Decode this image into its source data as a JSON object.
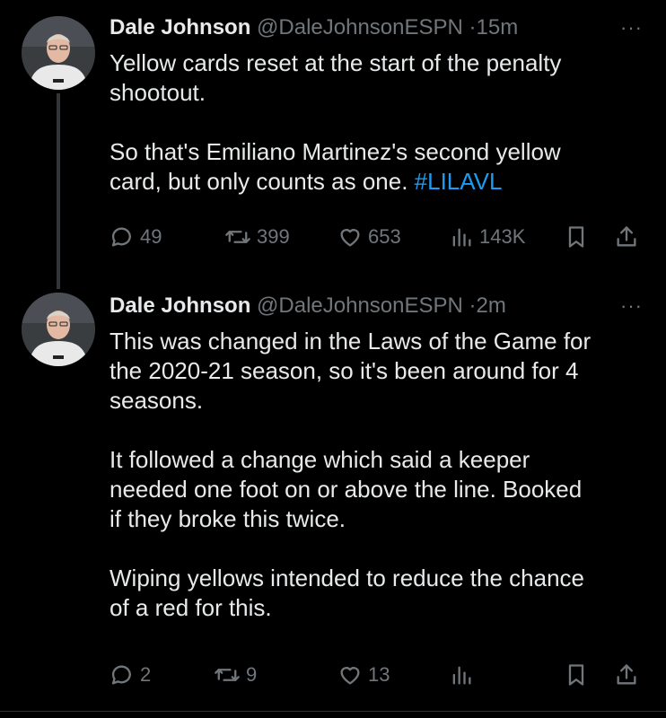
{
  "tweets": [
    {
      "name": "Dale Johnson",
      "handle": "@DaleJohnsonESPN",
      "separator": "·",
      "time": "15m",
      "more": "···",
      "text_before_tag": "Yellow cards reset at the start of the penalty\nshootout.\n\nSo that's Emiliano Martinez's second yellow\ncard, but only counts as one. ",
      "hashtag": "#LILAVL",
      "replies": "49",
      "reposts": "399",
      "likes": "653",
      "views": "143K"
    },
    {
      "name": "Dale Johnson",
      "handle": "@DaleJohnsonESPN",
      "separator": "·",
      "time": "2m",
      "more": "···",
      "text": "This was changed in the Laws of the Game for\nthe 2020-21 season, so it's been around for 4\nseasons.\n\nIt followed a change which said a keeper\nneeded one foot on or above the line. Booked\nif they broke this twice.\n\nWiping yellows intended to reduce the chance\nof a red for this.",
      "replies": "2",
      "reposts": "9",
      "likes": "13",
      "views": ""
    }
  ],
  "icons": {
    "reply": "reply-icon",
    "repost": "repost-icon",
    "like": "heart-icon",
    "views": "views-icon",
    "bookmark": "bookmark-icon",
    "share": "share-icon"
  },
  "colors": {
    "background": "#000000",
    "text": "#e7e9ea",
    "muted": "#71767b",
    "link": "#1d9bf0"
  }
}
